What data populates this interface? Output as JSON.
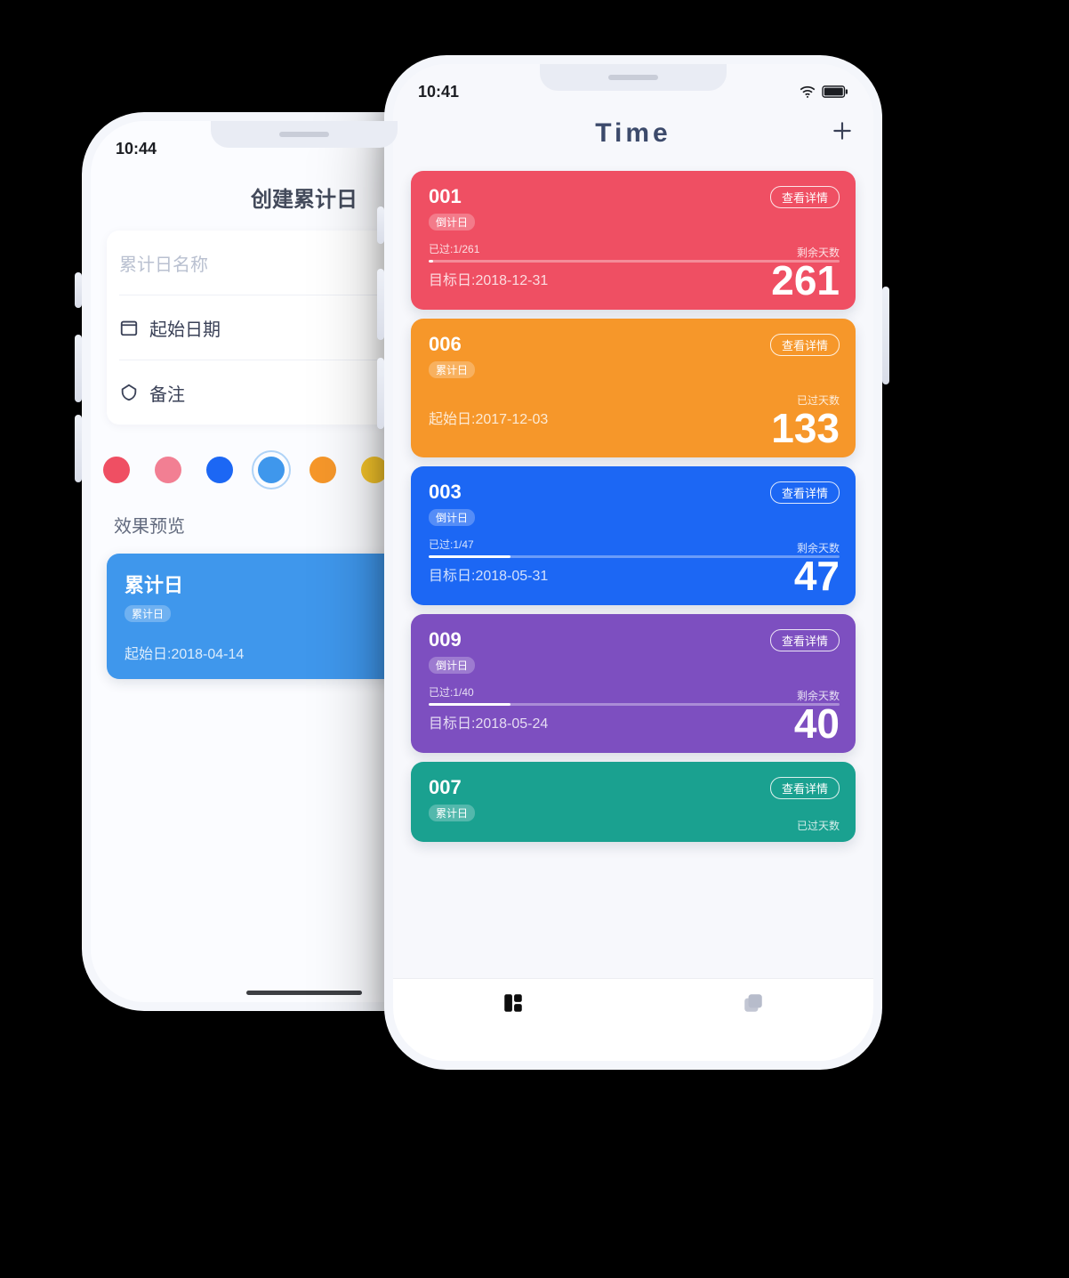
{
  "left": {
    "status_time": "10:44",
    "header": "创建累计日",
    "name_placeholder": "累计日名称",
    "start_label": "起始日期",
    "note_label": "备注",
    "colors": [
      {
        "name": "red",
        "hex": "#ef4f63"
      },
      {
        "name": "pink",
        "hex": "#f27f93"
      },
      {
        "name": "blue",
        "hex": "#1c67f4"
      },
      {
        "name": "sky",
        "hex": "#3f97ec",
        "selected": true
      },
      {
        "name": "orange",
        "hex": "#f6972a"
      },
      {
        "name": "yellow",
        "hex": "#f6c52a"
      }
    ],
    "preview_label": "效果预览",
    "preview_card": {
      "title": "累计日",
      "tag": "累计日",
      "dateline": "起始日:2018-04-14",
      "bg": "#3f97ec"
    }
  },
  "right": {
    "status_time": "10:41",
    "header": "Time",
    "cards": [
      {
        "id": "001",
        "tag": "倒计日",
        "progress_text": "已过:1/261",
        "progress_pct": 1,
        "dateline": "目标日:2018-12-31",
        "count_label": "剩余天数",
        "count": "261",
        "detail": "查看详情",
        "type": "countdown",
        "bg": "#ef4f63"
      },
      {
        "id": "006",
        "tag": "累计日",
        "dateline": "起始日:2017-12-03",
        "count_label": "已过天数",
        "count": "133",
        "detail": "查看详情",
        "type": "accum",
        "bg": "#f6972a"
      },
      {
        "id": "003",
        "tag": "倒计日",
        "progress_text": "已过:1/47",
        "progress_pct": 20,
        "dateline": "目标日:2018-05-31",
        "count_label": "剩余天数",
        "count": "47",
        "detail": "查看详情",
        "type": "countdown",
        "bg": "#1c67f4"
      },
      {
        "id": "009",
        "tag": "倒计日",
        "progress_text": "已过:1/40",
        "progress_pct": 20,
        "dateline": "目标日:2018-05-24",
        "count_label": "剩余天数",
        "count": "40",
        "detail": "查看详情",
        "type": "countdown",
        "bg": "#7d4fc0"
      },
      {
        "id": "007",
        "tag": "累计日",
        "count_label": "已过天数",
        "detail": "查看详情",
        "type": "accum",
        "bg": "#1aa190",
        "cut": true
      }
    ]
  }
}
